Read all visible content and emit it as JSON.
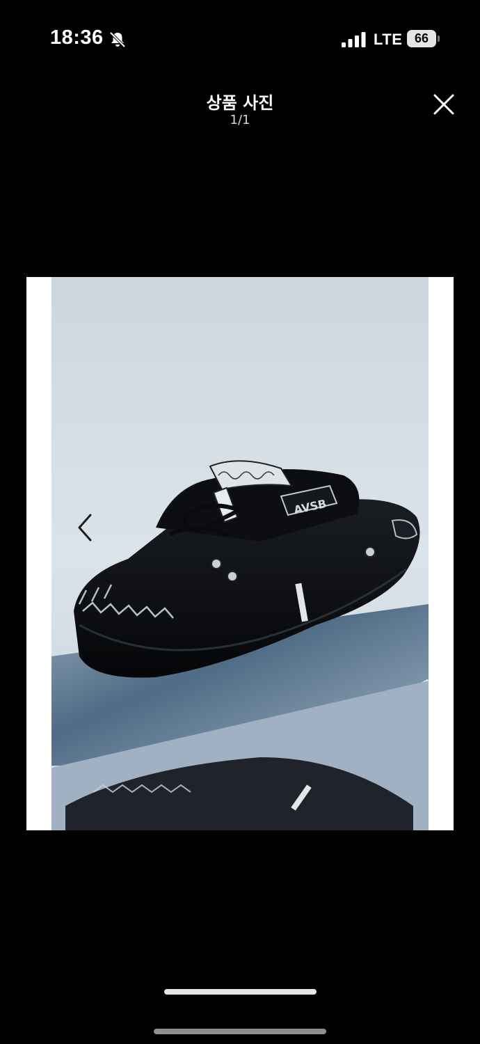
{
  "status_bar": {
    "time": "18:36",
    "carrier": "LTE",
    "battery": "66",
    "icons": [
      "bell-slash-icon",
      "signal-bars-icon",
      "battery-icon"
    ]
  },
  "header": {
    "title": "상품 사진",
    "counter": "1/1",
    "close_icon": "close-icon"
  },
  "viewer": {
    "prev_icon": "chevron-left-icon",
    "strap_text": "AVSB"
  },
  "colors": {
    "background": "#000000",
    "text": "#ffffff",
    "photo_frame": "#ffffff"
  }
}
